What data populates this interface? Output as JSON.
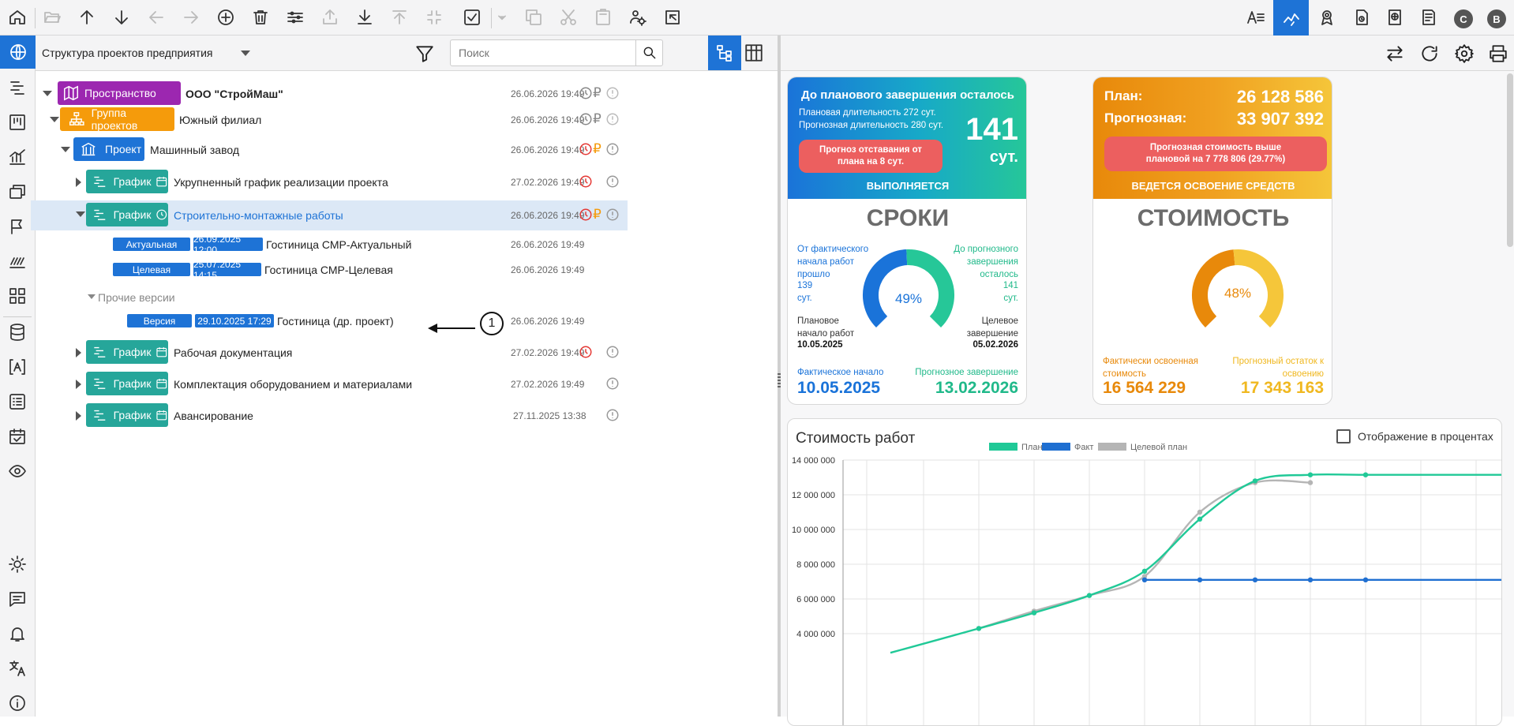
{
  "toolbar": {
    "left_icons": [
      "home-icon",
      "folder-open-icon",
      "arrow-up-icon",
      "arrow-down-icon",
      "arrow-left-icon",
      "arrow-right-icon",
      "add-circle-icon",
      "trash-icon",
      "sliders-icon",
      "upload-tray-icon",
      "download-icon",
      "export-icon",
      "collapse-icon",
      "checkbox-icon",
      "dropdown-icon",
      "copy-icon",
      "cut-icon",
      "paste-icon",
      "cog-people-icon",
      "share-box-icon"
    ],
    "right_icons": [
      "text-size-icon",
      "analytics-icon",
      "award-icon",
      "report-clock-icon",
      "web-doc-icon",
      "document-icon"
    ],
    "avatar_c": "C",
    "avatar_b": "B"
  },
  "left_panel": {
    "title": "Структура проектов предприятия",
    "search_placeholder": "Поиск"
  },
  "tree": {
    "space": {
      "badge": "Пространство",
      "name": "ООО \"СтройМаш\"",
      "date": "26.06.2026 19:49"
    },
    "group": {
      "badge": "Группа проектов",
      "name": "Южный филиал",
      "date": "26.06.2026 19:49"
    },
    "project": {
      "badge": "Проект",
      "name": "Машинный завод",
      "date": "26.06.2026 19:49"
    },
    "schedules": [
      {
        "badge": "График",
        "name": "Укрупненный график реализации проекта",
        "date": "27.02.2026 19:49"
      },
      {
        "badge": "График",
        "name": "Строительно-монтажные работы",
        "date": "26.06.2026 19:49"
      }
    ],
    "versions": [
      {
        "type": "Актуальная",
        "stamp": "26.09.2025 12:00",
        "name": "Гостиница СМР-Актуальный",
        "date": "26.06.2026 19:49"
      },
      {
        "type": "Целевая",
        "stamp": "25.07.2025 14:15",
        "name": "Гостиница СМР-Целевая",
        "date": "26.06.2026 19:49"
      }
    ],
    "other_versions_label": "Прочие версии",
    "other_version": {
      "type": "Версия",
      "stamp": "29.10.2025 17:29",
      "name": "Гостиница (др. проект)",
      "date": "26.06.2026 19:49"
    },
    "callout": "1",
    "more_schedules": [
      {
        "badge": "График",
        "name": "Рабочая документация",
        "date": "27.02.2026 19:49"
      },
      {
        "badge": "График",
        "name": "Комплектация оборудованием и материалами",
        "date": "27.02.2026 19:49"
      },
      {
        "badge": "График",
        "name": "Авансирование",
        "date": "27.11.2025 13:38"
      }
    ]
  },
  "timing_card": {
    "header": "До планового завершения осталось",
    "planned_duration": "Плановая длительность 272 сут.",
    "forecast_duration": "Прогнозная длительность 280 сут.",
    "big_number": "141",
    "big_unit": "сут.",
    "alert": "Прогноз отставания от плана на 8 сут.",
    "status": "ВЫПОЛНЯЕТСЯ",
    "title": "СРОКИ",
    "elapsed_label": "От фактического начала работ прошло",
    "elapsed_value": "139",
    "elapsed_unit": "сут.",
    "remaining_label": "До прогнозного завершения осталось",
    "remaining_value": "141",
    "remaining_unit": "сут.",
    "gauge_percent": 49,
    "gauge_label": "49%",
    "plan_start_label": "Плановое начало работ",
    "plan_start_value": "10.05.2025",
    "target_end_label": "Целевое завершение",
    "target_end_value": "05.02.2026",
    "actual_start_label": "Фактическое начало",
    "actual_start_value": "10.05.2025",
    "forecast_end_label": "Прогнозное завершение",
    "forecast_end_value": "13.02.2026"
  },
  "cost_card": {
    "plan_label": "План:",
    "plan_value": "26 128 586",
    "forecast_label": "Прогнозная:",
    "forecast_value": "33 907 392",
    "alert": "Прогнозная стоимость выше плановой на 7 778 806 (29.77%)",
    "status": "ВЕДЕТСЯ ОСВОЕНИЕ СРЕДСТВ",
    "title": "СТОИМОСТЬ",
    "gauge_percent": 48,
    "gauge_label": "48%",
    "spent_label": "Фактически освоенная стоимость",
    "spent_value": "16 564 229",
    "remain_label": "Прогнозный остаток к освоению",
    "remain_value": "17 343 163"
  },
  "chart_panel": {
    "title": "Стоимость работ",
    "percent_toggle_label": "Отображение в процентах"
  },
  "chart_data": {
    "type": "line",
    "title": "Стоимость работ",
    "ylim": [
      2800000,
      14000000
    ],
    "yticks": [
      "14 000 000",
      "12 000 000",
      "10 000 000",
      "8 000 000",
      "6 000 000",
      "4 000 000"
    ],
    "ytick_values": [
      14000000,
      12000000,
      10000000,
      8000000,
      6000000,
      4000000
    ],
    "x_count": 10,
    "legend": [
      "План",
      "Факт",
      "Целевой план"
    ],
    "colors": {
      "План": "#20c997",
      "Факт": "#1f6fd1",
      "Целевой план": "#b5b5b5"
    },
    "series": [
      {
        "name": "План",
        "values": [
          null,
          2900000,
          4300000,
          5200000,
          6200000,
          7600000,
          10600000,
          12800000,
          13150000,
          13150000
        ]
      },
      {
        "name": "Факт",
        "values": [
          null,
          null,
          null,
          null,
          null,
          7100000,
          7100000,
          7100000,
          7100000,
          7100000
        ]
      },
      {
        "name": "Целевой план",
        "values": [
          null,
          null,
          4300000,
          5300000,
          6200000,
          7300000,
          11000000,
          12700000,
          12700000,
          null
        ]
      }
    ]
  }
}
